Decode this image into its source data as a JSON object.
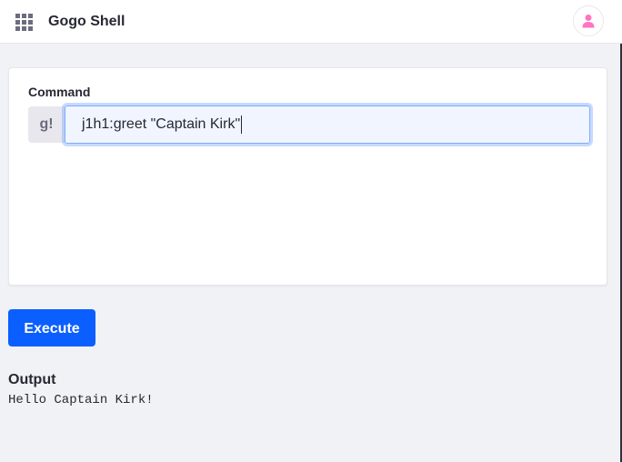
{
  "header": {
    "title": "Gogo Shell",
    "apps_icon": "apps-grid-icon",
    "user_icon": "user-icon"
  },
  "command": {
    "label": "Command",
    "prefix": "g!",
    "value": "j1h1:greet \"Captain Kirk\""
  },
  "actions": {
    "execute_label": "Execute"
  },
  "output": {
    "label": "Output",
    "text": "Hello Captain Kirk!"
  },
  "colors": {
    "accent": "#0b5fff",
    "user_icon": "#ff73c3"
  }
}
